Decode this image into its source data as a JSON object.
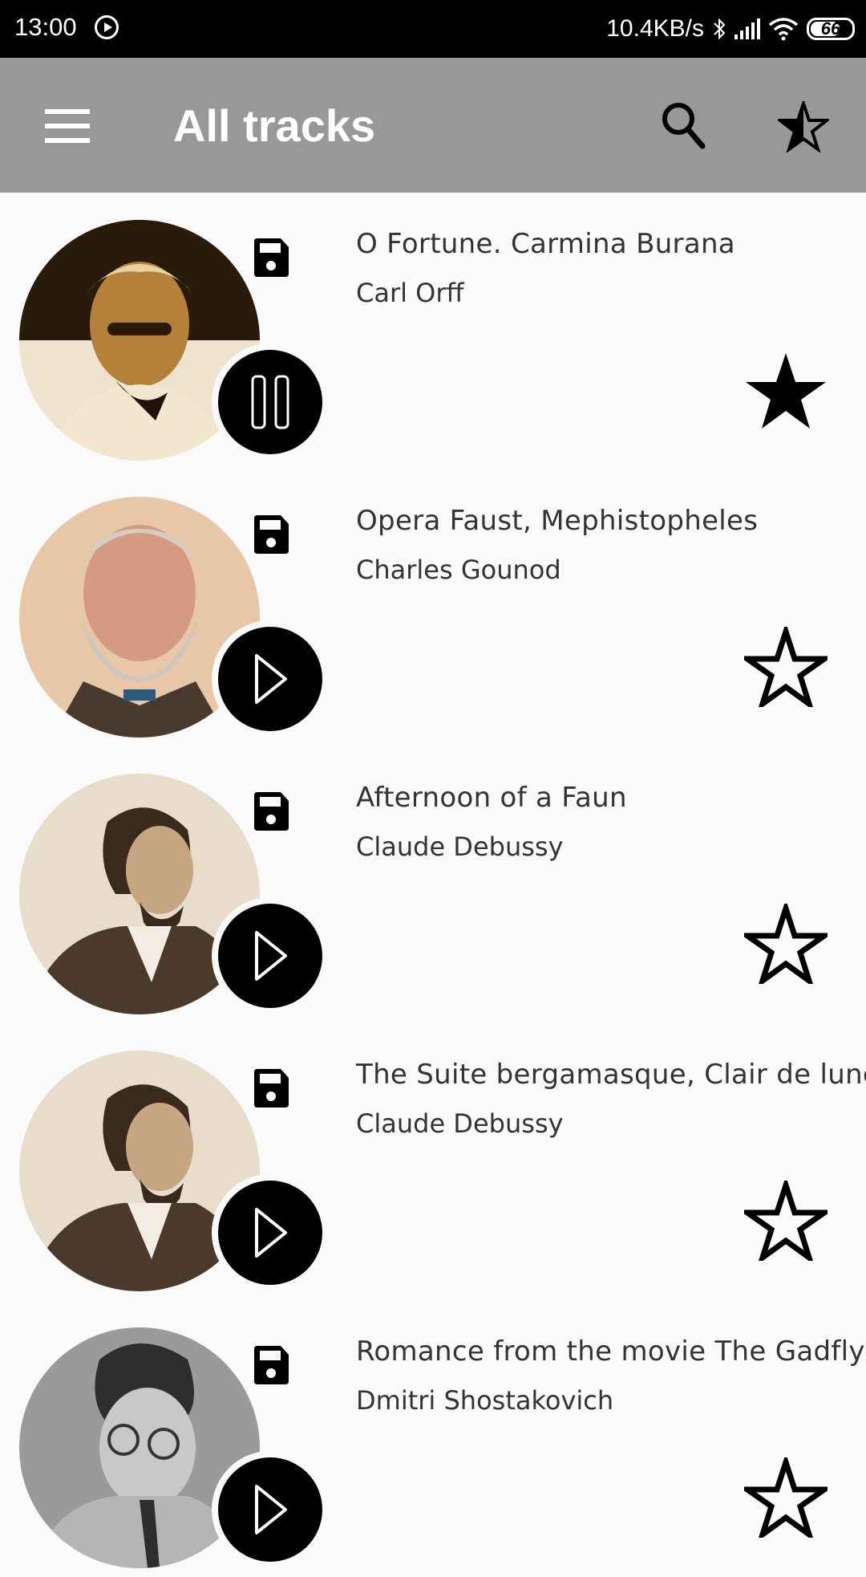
{
  "status_bar": {
    "time": "13:00",
    "network_speed": "10.4KB/s",
    "battery_level": "66",
    "icons": [
      "media-playing-icon",
      "bluetooth-icon",
      "signal-icon",
      "wifi-icon",
      "battery-icon"
    ]
  },
  "app_bar": {
    "title": "All tracks",
    "icons": {
      "menu": "hamburger-menu-icon",
      "search": "search-icon",
      "favorites": "half-star-icon"
    }
  },
  "tracks": [
    {
      "title": "O Fortune. Carmina Burana",
      "artist": "Carl Orff",
      "state": "playing",
      "favorite": true,
      "saved": true
    },
    {
      "title": "Opera Faust, Mephistopheles",
      "artist": "Charles Gounod",
      "state": "paused",
      "favorite": false,
      "saved": true
    },
    {
      "title": "Afternoon of a Faun",
      "artist": "Claude Debussy",
      "state": "paused",
      "favorite": false,
      "saved": true
    },
    {
      "title": "The Suite bergamasque, Clair de lune",
      "artist": "Claude Debussy",
      "state": "paused",
      "favorite": false,
      "saved": true
    },
    {
      "title": "Romance from the movie The Gadfly",
      "artist": "Dmitri Shostakovich",
      "state": "paused",
      "favorite": false,
      "saved": true
    }
  ],
  "colors": {
    "app_bar": "#989898",
    "background": "#fafafa",
    "text": "#333333",
    "status_bar": "#000000"
  }
}
